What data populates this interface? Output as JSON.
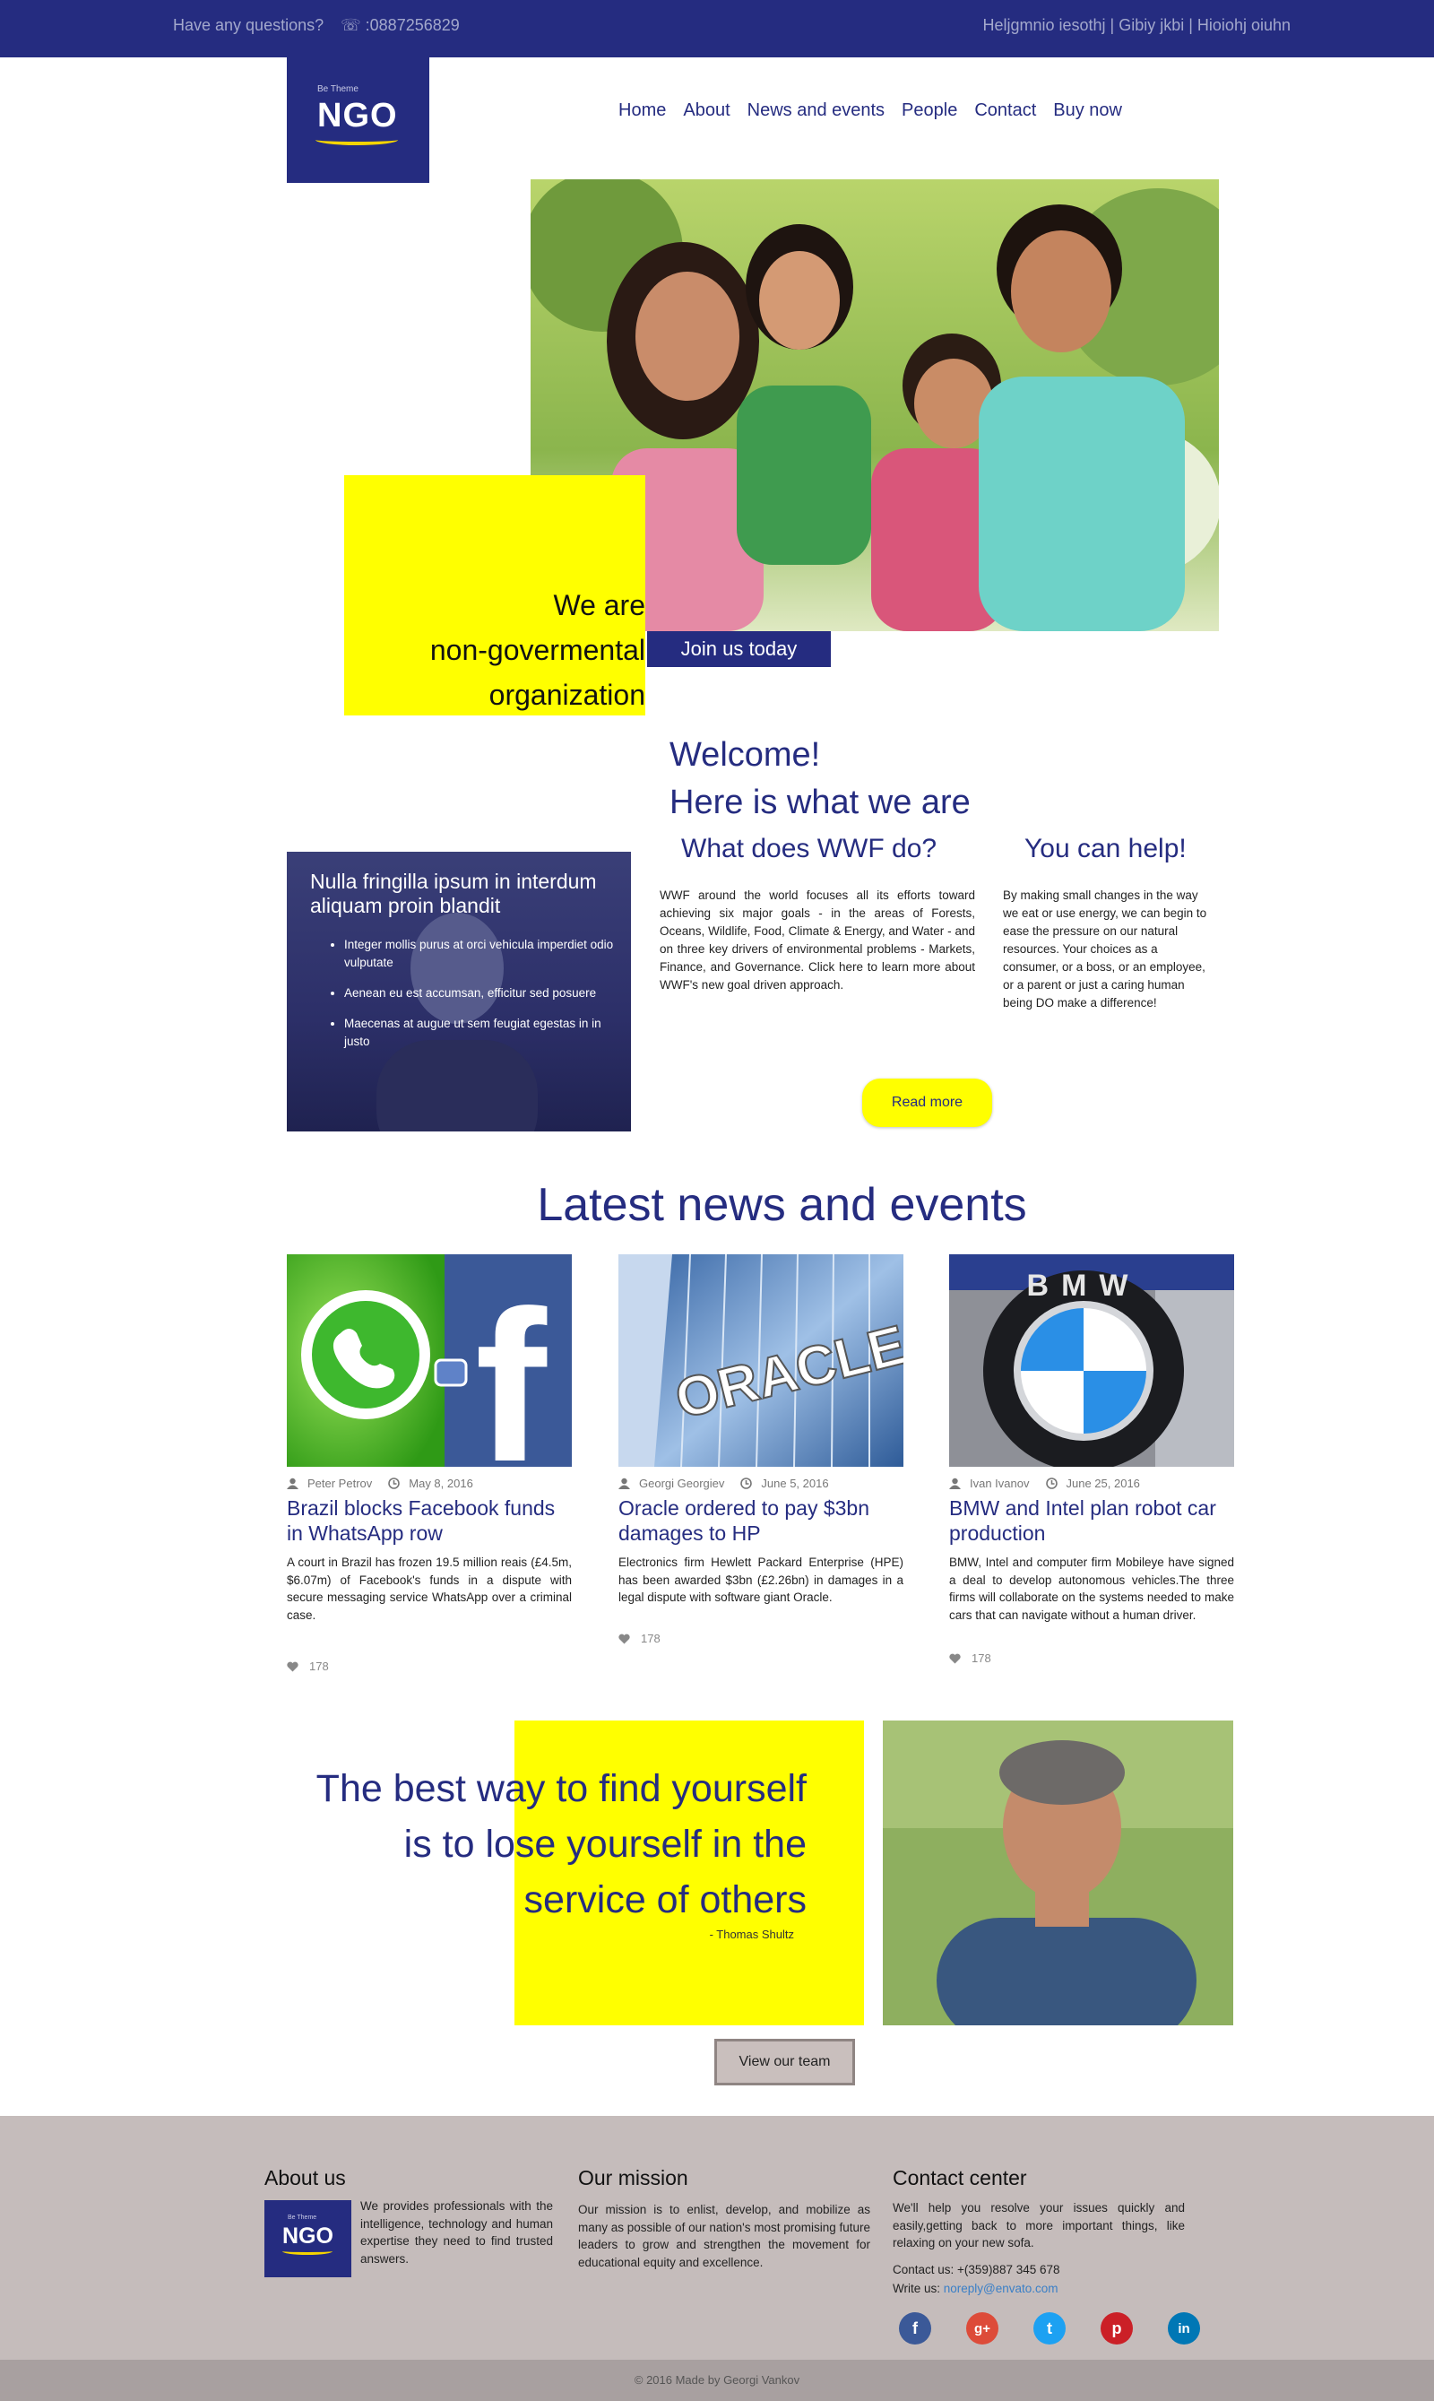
{
  "topbar": {
    "question": "Have any questions?",
    "phone": ":0887256829",
    "right_links": "Heljgmnio iesothj | Gibiy jkbi | Hioiohj oiuhn"
  },
  "logo": {
    "small": "Be Theme",
    "big": "NGO"
  },
  "nav": [
    "Home",
    "About",
    "News and events",
    "People",
    "Contact",
    "Buy now"
  ],
  "hero": {
    "line1": "We are",
    "line2": "non-govermental",
    "line3": "organization",
    "cta": "Join us today"
  },
  "welcome": {
    "line1": "Welcome!",
    "line2": "Here is what we are",
    "col1_title": "What does WWF do?",
    "col1_text": "WWF around the world focuses all its efforts toward achieving six major goals - in the areas of Forests, Oceans, Wildlife, Food, Climate & Energy, and Water - and on three key drivers of environmental problems - Markets, Finance, and Governance. Click here to learn more about WWF's new goal driven approach.",
    "col2_title": "You can help!",
    "col2_text": "By making small changes in the way we eat or use energy, we can begin to ease the pressure on our natural resources. Your choices as a consumer, or a boss, or an employee, or a parent or just a caring human being DO make a difference!",
    "read_more": "Read more"
  },
  "side_panel": {
    "title": "Nulla fringilla ipsum in interdum aliquam proin blandit",
    "items": [
      "Integer mollis purus at orci vehicula imperdiet odio vulputate",
      "Aenean eu est accumsan, efficitur sed posuere",
      "Maecenas at augue ut sem feugiat egestas in in justo"
    ]
  },
  "news": {
    "heading": "Latest news and events",
    "items": [
      {
        "author": "Peter Petrov",
        "date": "May 8, 2016",
        "title": "Brazil blocks Facebook funds in WhatsApp row",
        "text": "A court in Brazil has frozen 19.5 million reais (£4.5m, $6.07m) of Facebook's funds in a dispute with secure messaging service WhatsApp over a criminal case.",
        "likes": "178"
      },
      {
        "author": "Georgi Georgiev",
        "date": "June 5, 2016",
        "title": "Oracle ordered to pay $3bn damages to HP",
        "text": "Electronics firm Hewlett Packard Enterprise (HPE) has been awarded $3bn (£2.26bn) in damages in a legal dispute with software giant Oracle.",
        "likes": "178",
        "image_text": "ORACLE"
      },
      {
        "author": "Ivan Ivanov",
        "date": "June 25, 2016",
        "title": "BMW and Intel plan robot car production",
        "text": "BMW, Intel and computer firm Mobileye have signed a deal to develop autonomous vehicles.The three firms will collaborate on the systems needed to make cars that can navigate without a human driver.",
        "likes": "178",
        "image_text": "BMW"
      }
    ]
  },
  "quote": {
    "line1": "The best way to find yourself",
    "line2": "is to lose yourself in the",
    "line3": "service of others",
    "author": "- Thomas Shultz",
    "button": "View our team"
  },
  "footer": {
    "about_title": "About us",
    "about_text": "We provides professionals with the intelligence, technology and human expertise they need to find trusted answers.",
    "mission_title": "Our mission",
    "mission_text": "Our mission is to enlist, develop, and mobilize as many as possible of our nation's most promising future leaders to grow and strengthen the movement for educational equity and excellence.",
    "contact_title": "Contact center",
    "contact_text": "We'll help you resolve your issues quickly and easily,getting back to more important things, like relaxing on your new sofa.",
    "contact_phone": "Contact us: +(359)887 345 678",
    "write_label": "Write us: ",
    "write_email": "noreply@envato.com",
    "social": [
      {
        "name": "facebook-icon",
        "glyph": "f",
        "color": "#3b5998"
      },
      {
        "name": "google-plus-icon",
        "glyph": "g+",
        "color": "#dd4b39"
      },
      {
        "name": "twitter-icon",
        "glyph": "t",
        "color": "#1da1f2"
      },
      {
        "name": "pinterest-icon",
        "glyph": "p",
        "color": "#cb2027"
      },
      {
        "name": "linkedin-icon",
        "glyph": "in",
        "color": "#0077b5"
      }
    ],
    "copyright": "© 2016 Made by Georgi Vankov"
  },
  "colors": {
    "brand": "#252c80",
    "accent": "#ffff00",
    "footer": "#c5bcbb"
  }
}
